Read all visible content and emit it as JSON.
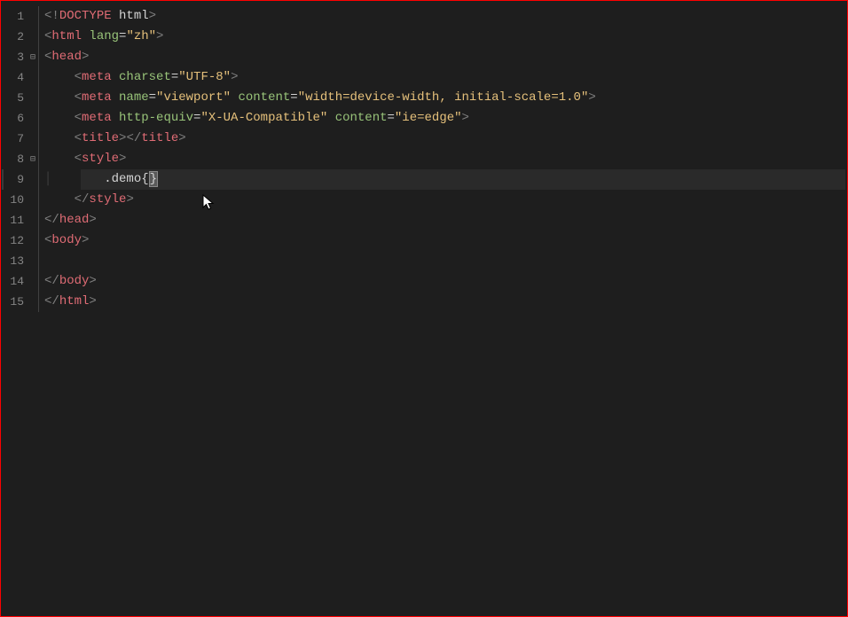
{
  "lines": [
    {
      "num": "1",
      "fold": ""
    },
    {
      "num": "2",
      "fold": ""
    },
    {
      "num": "3",
      "fold": "⊟"
    },
    {
      "num": "4",
      "fold": ""
    },
    {
      "num": "5",
      "fold": ""
    },
    {
      "num": "6",
      "fold": ""
    },
    {
      "num": "7",
      "fold": ""
    },
    {
      "num": "8",
      "fold": "⊟"
    },
    {
      "num": "9",
      "fold": ""
    },
    {
      "num": "10",
      "fold": ""
    },
    {
      "num": "11",
      "fold": ""
    },
    {
      "num": "12",
      "fold": ""
    },
    {
      "num": "13",
      "fold": ""
    },
    {
      "num": "14",
      "fold": ""
    },
    {
      "num": "15",
      "fold": ""
    }
  ],
  "code": {
    "l1_lt": "<!",
    "l1_doctype": "DOCTYPE",
    "l1_html": "html",
    "l1_gt": ">",
    "l2_lt": "<",
    "l2_html": "html",
    "l2_sp": " ",
    "l2_lang": "lang",
    "l2_eq": "=",
    "l2_val": "\"zh\"",
    "l2_gt": ">",
    "l3_lt": "<",
    "l3_head": "head",
    "l3_gt": ">",
    "l4_indent": "    ",
    "l4_lt": "<",
    "l4_meta": "meta",
    "l4_sp": " ",
    "l4_charset": "charset",
    "l4_eq": "=",
    "l4_val": "\"UTF-8\"",
    "l4_gt": ">",
    "l5_indent": "    ",
    "l5_lt": "<",
    "l5_meta": "meta",
    "l5_sp": " ",
    "l5_name": "name",
    "l5_eq": "=",
    "l5_val1": "\"viewport\"",
    "l5_sp2": " ",
    "l5_content": "content",
    "l5_eq2": "=",
    "l5_val2": "\"width=device-width, initial-scale=1.0\"",
    "l5_gt": ">",
    "l6_indent": "    ",
    "l6_lt": "<",
    "l6_meta": "meta",
    "l6_sp": " ",
    "l6_httpeq": "http-equiv",
    "l6_eq": "=",
    "l6_val1": "\"X-UA-Compatible\"",
    "l6_sp2": " ",
    "l6_content": "content",
    "l6_eq2": "=",
    "l6_val2": "\"ie=edge\"",
    "l6_gt": ">",
    "l7_indent": "    ",
    "l7_lt": "<",
    "l7_title": "title",
    "l7_gt": ">",
    "l7_lt2": "</",
    "l7_title2": "title",
    "l7_gt2": ">",
    "l8_indent": "    ",
    "l8_lt": "<",
    "l8_style": "style",
    "l8_gt": ">",
    "l9_indent": "        ",
    "l9_sel": ".demo",
    "l9_lb": "{",
    "l9_rb": "}",
    "l10_indent": "    ",
    "l10_lt": "</",
    "l10_style": "style",
    "l10_gt": ">",
    "l11_lt": "</",
    "l11_head": "head",
    "l11_gt": ">",
    "l12_lt": "<",
    "l12_body": "body",
    "l12_gt": ">",
    "l13_indent": "    ",
    "l14_lt": "</",
    "l14_body": "body",
    "l14_gt": ">",
    "l15_lt": "</",
    "l15_html": "html",
    "l15_gt": ">"
  }
}
